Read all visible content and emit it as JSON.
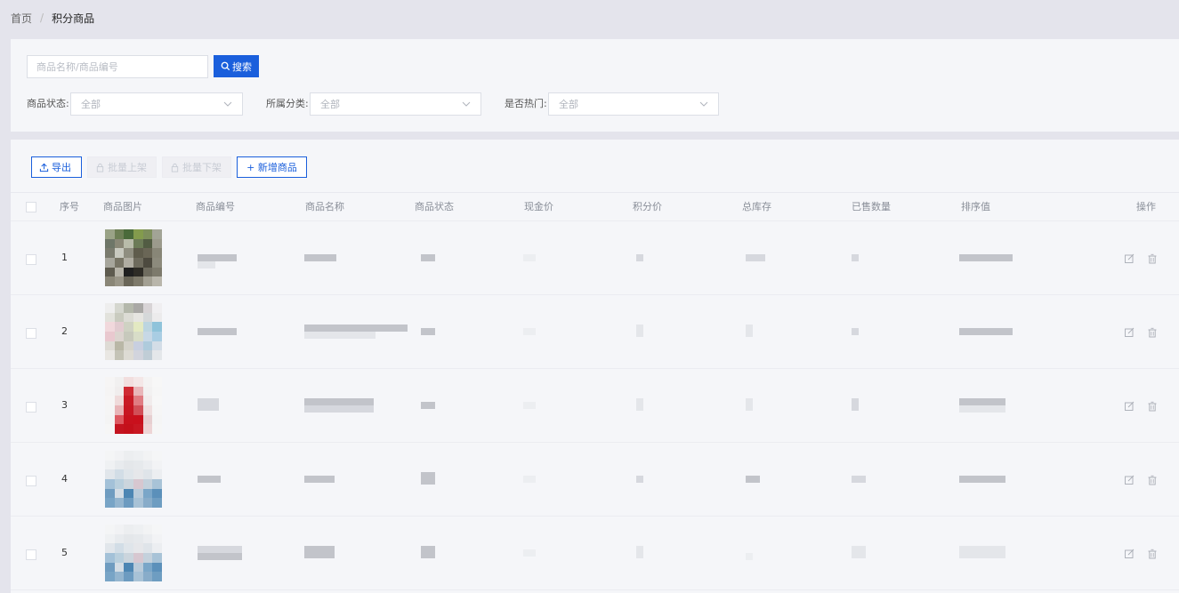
{
  "breadcrumb": {
    "home": "首页",
    "separator": "/",
    "current": "积分商品"
  },
  "search": {
    "placeholder": "商品名称/商品编号",
    "value": "",
    "button_label": "搜索"
  },
  "filters": [
    {
      "label": "商品状态:",
      "value": "全部"
    },
    {
      "label": "所属分类:",
      "value": "全部"
    },
    {
      "label": "是否热门:",
      "value": "全部"
    }
  ],
  "toolbar": {
    "export_label": "导出",
    "batch_on_label": "批量上架",
    "batch_off_label": "批量下架",
    "add_label": "+ 新增商品"
  },
  "table": {
    "columns": [
      "序号",
      "商品图片",
      "商品编号",
      "商品名称",
      "商品状态",
      "现金价",
      "积分价",
      "总库存",
      "已售数量",
      "排序值",
      "操作"
    ],
    "rows": [
      {
        "seq": "1"
      },
      {
        "seq": "2"
      },
      {
        "seq": "3"
      },
      {
        "seq": "4"
      },
      {
        "seq": "5"
      }
    ]
  },
  "icons": {
    "search": "search-icon",
    "dropdown": "chevron-down-icon",
    "export": "upload-icon",
    "batch": "lock-icon",
    "edit": "edit-icon",
    "delete": "trash-icon"
  },
  "colors": {
    "primary": "#1a5fdc",
    "page_bg": "#e4e4ec",
    "panel_bg": "#f5f6f9"
  }
}
